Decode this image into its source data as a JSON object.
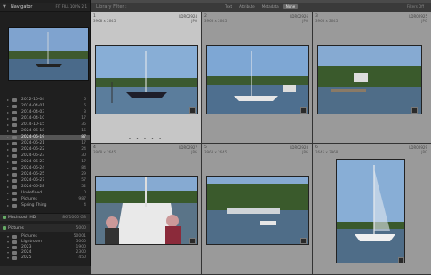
{
  "navigator": {
    "title": "Navigator",
    "options": "FIT  FILL  100%  2:1"
  },
  "folders": {
    "items": [
      {
        "label": "2012-10-04",
        "count": "6"
      },
      {
        "label": "2014-04-01",
        "count": "6"
      },
      {
        "label": "2014-04-03",
        "count": "3"
      },
      {
        "label": "2014-04-10",
        "count": "17"
      },
      {
        "label": "2014-10-15",
        "count": "35"
      },
      {
        "label": "2024-06-18",
        "count": "15"
      },
      {
        "label": "2024-06-19",
        "count": "87"
      },
      {
        "label": "2024-06-21",
        "count": "17"
      },
      {
        "label": "2024-06-22",
        "count": "24"
      },
      {
        "label": "2024-06-23",
        "count": "30"
      },
      {
        "label": "2024-06-23",
        "count": "17"
      },
      {
        "label": "2024-06-24",
        "count": "84"
      },
      {
        "label": "2024-06-25",
        "count": "29"
      },
      {
        "label": "2024-06-27",
        "count": "57"
      },
      {
        "label": "2024-06-28",
        "count": "52"
      },
      {
        "label": "Undefined",
        "count": "0"
      },
      {
        "label": "Pictures",
        "count": "987"
      },
      {
        "label": "Spring Thing",
        "count": "4"
      }
    ],
    "selected_index": 6
  },
  "volumes": [
    {
      "label": "Macintosh HD",
      "count": "86/1000 GB"
    },
    {
      "label": "Pictures",
      "count": "5000"
    }
  ],
  "subfolders": [
    {
      "label": "Pictures",
      "count": "50001"
    },
    {
      "label": "Lightroom",
      "count": "5000"
    },
    {
      "label": "2023",
      "count": "1900"
    },
    {
      "label": "2024",
      "count": "2300"
    },
    {
      "label": "2025",
      "count": "450"
    }
  ],
  "toolbar": {
    "path": "Library Filter :",
    "tabs": [
      "Text",
      "Attribute",
      "Metadata",
      "None"
    ],
    "active_tab": "None",
    "preset": "Filters Off"
  },
  "grid": {
    "cells": [
      {
        "num": "1",
        "fname": "LDR02924",
        "dims": "3968 x 2645",
        "ext": "JPG"
      },
      {
        "num": "2",
        "fname": "LDR02926",
        "dims": "3968 x 2645",
        "ext": "JPG"
      },
      {
        "num": "3",
        "fname": "LDR02925",
        "dims": "3968 x 2645",
        "ext": "JPG"
      },
      {
        "num": "4",
        "fname": "LDR02927",
        "dims": "3968 x 2645",
        "ext": "JPG"
      },
      {
        "num": "5",
        "fname": "LDR02928",
        "dims": "3968 x 2645",
        "ext": "JPG"
      },
      {
        "num": "6",
        "fname": "LDR02929",
        "dims": "2645 x 3968",
        "ext": "JPG"
      }
    ]
  },
  "colors": {
    "panel": "#1f1f1f",
    "grid_bg": "#4a4a4a",
    "cell": "#9a9a9a",
    "cell_selected": "#c6c6c6",
    "sky": "#7fa3cf",
    "water": "#4a6a8a",
    "trees": "#3e5a2e"
  }
}
